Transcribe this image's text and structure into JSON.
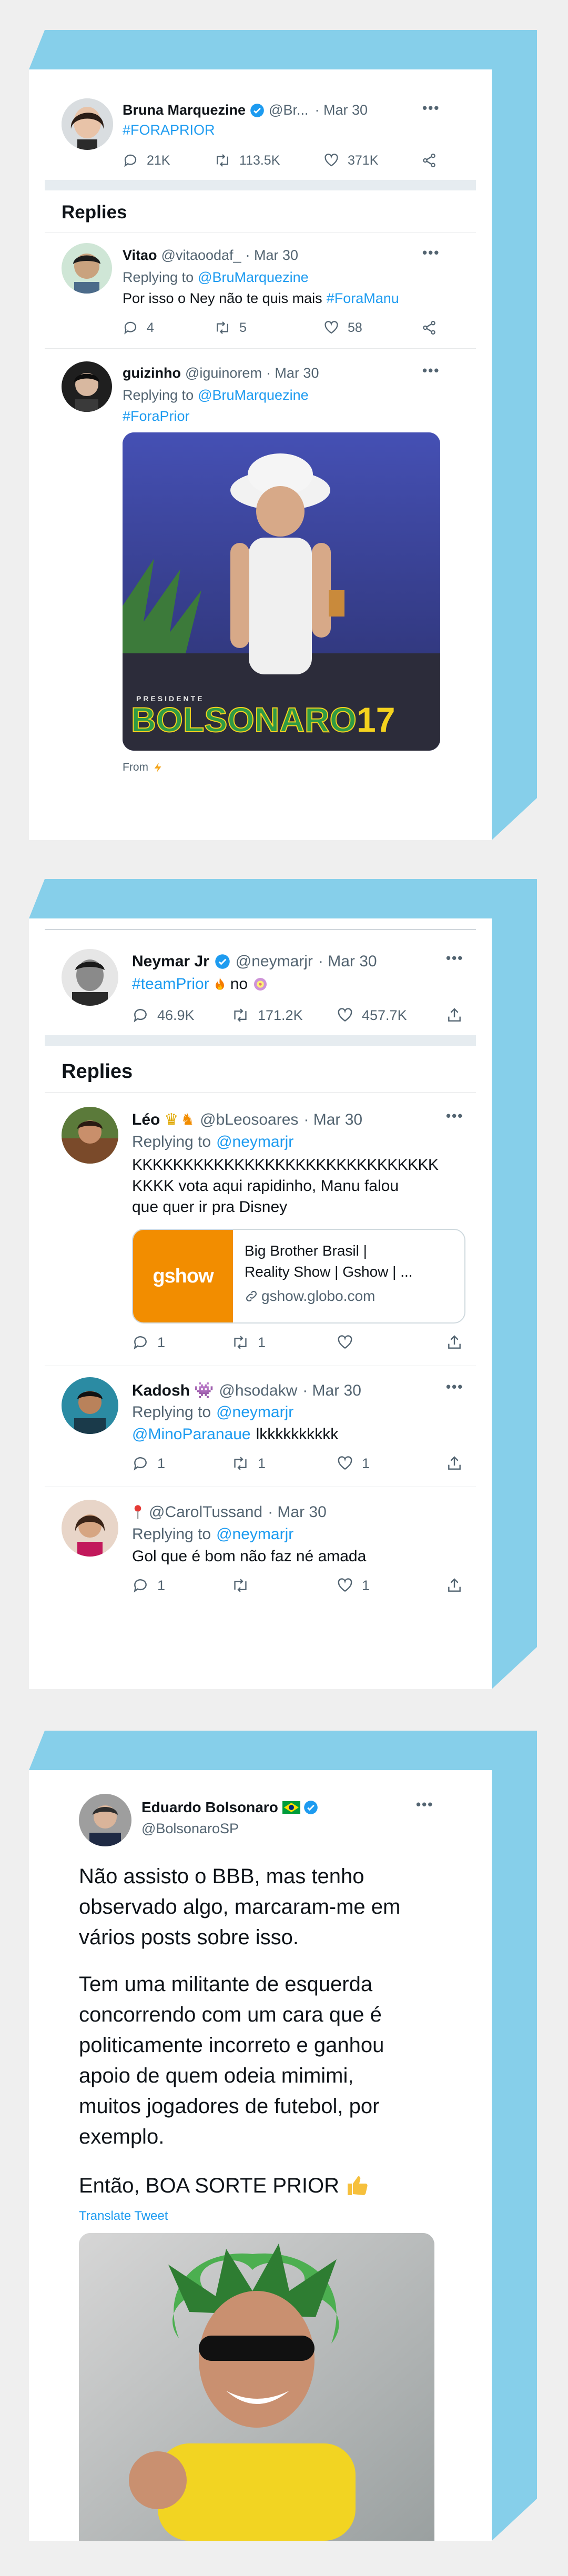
{
  "panel1": {
    "main": {
      "name": "Bruna Marquezine",
      "handle": "@Br...",
      "date": "· Mar 30",
      "text": "#FORAPRIOR",
      "replies": "21K",
      "retweets": "113.5K",
      "likes": "371K"
    },
    "replies_heading": "Replies",
    "reply1": {
      "name": "Vitao",
      "handle": "@vitaoodaf_",
      "date": "· Mar 30",
      "replying_prefix": "Replying to",
      "replying_to": "@BruMarquezine",
      "text": "Por isso o Ney não te quis mais",
      "hashtag": "#ForaManu",
      "replies": "4",
      "retweets": "5",
      "likes": "58"
    },
    "reply2": {
      "name": "guizinho",
      "handle": "@iguinorem",
      "date": "· Mar 30",
      "replying_prefix": "Replying to",
      "replying_to": "@BruMarquezine",
      "hashtag": "#ForaPrior",
      "image_overlay_small": "PRESIDENTE",
      "image_overlay_big": "BOLSONARO",
      "image_overlay_num": "17",
      "from_label": "From"
    }
  },
  "panel2": {
    "main": {
      "name": "Neymar Jr",
      "handle": "@neymarjr",
      "date": "· Mar 30",
      "hashtag": "#teamPrior",
      "text_after": "no",
      "replies": "46.9K",
      "retweets": "171.2K",
      "likes": "457.7K"
    },
    "replies_heading": "Replies",
    "reply1": {
      "name": "Léo",
      "handle": "@bLeosoares",
      "date": "· Mar 30",
      "replying_prefix": "Replying to",
      "replying_to": "@neymarjr",
      "text_line1": "KKKKKKKKKKKKKKKKKKKKKKKKKKKKKK",
      "text_line2": "KKKK vota aqui rapidinho, Manu falou",
      "text_line3": "que quer ir pra Disney",
      "card_logo": "gshow",
      "card_title_line1": "Big Brother Brasil |",
      "card_title_line2": "Reality Show | Gshow | ...",
      "card_domain": "gshow.globo.com",
      "replies": "1",
      "retweets": "1"
    },
    "reply2": {
      "name": "Kadosh",
      "handle": "@hsodakw",
      "date": "· Mar 30",
      "replying_prefix": "Replying to",
      "replying_to": "@neymarjr",
      "mention": "@MinoParanaue",
      "text": "lkkkkkkkkkk",
      "replies": "1",
      "retweets": "1",
      "likes": "1"
    },
    "reply3": {
      "handle": "@CarolTussand",
      "date": "· Mar 30",
      "replying_prefix": "Replying to",
      "replying_to": "@neymarjr",
      "text": "Gol que é bom não faz né amada",
      "replies": "1",
      "likes": "1"
    }
  },
  "panel3": {
    "name": "Eduardo Bolsonaro",
    "handle": "@BolsonaroSP",
    "para1_line1": "Não assisto o BBB, mas tenho",
    "para1_line2": "observado algo, marcaram-me em",
    "para1_line3": "vários posts sobre isso.",
    "para2_line1": "Tem uma militante de esquerda",
    "para2_line2": "concorrendo com um cara que é",
    "para2_line3": "politicamente incorreto e ganhou",
    "para2_line4": "apoio de quem odeia mimimi,",
    "para2_line5": "muitos jogadores de futebol, por",
    "para2_line6": "exemplo.",
    "para3": "Então, BOA SORTE PRIOR",
    "translate": "Translate Tweet"
  },
  "colors": {
    "accent": "#1d9bf0",
    "box_side": "#86cfea",
    "text": "#0f1419",
    "muted": "#536471",
    "gshow": "#f28d00"
  },
  "icons": [
    "verified-badge-icon",
    "more-options-icon",
    "reply-icon",
    "retweet-icon",
    "like-icon",
    "share-icon",
    "link-icon",
    "lightning-icon",
    "fire-emoji-icon",
    "prize-emoji-icon",
    "thumbs-up-emoji-icon",
    "brazil-flag-icon"
  ]
}
